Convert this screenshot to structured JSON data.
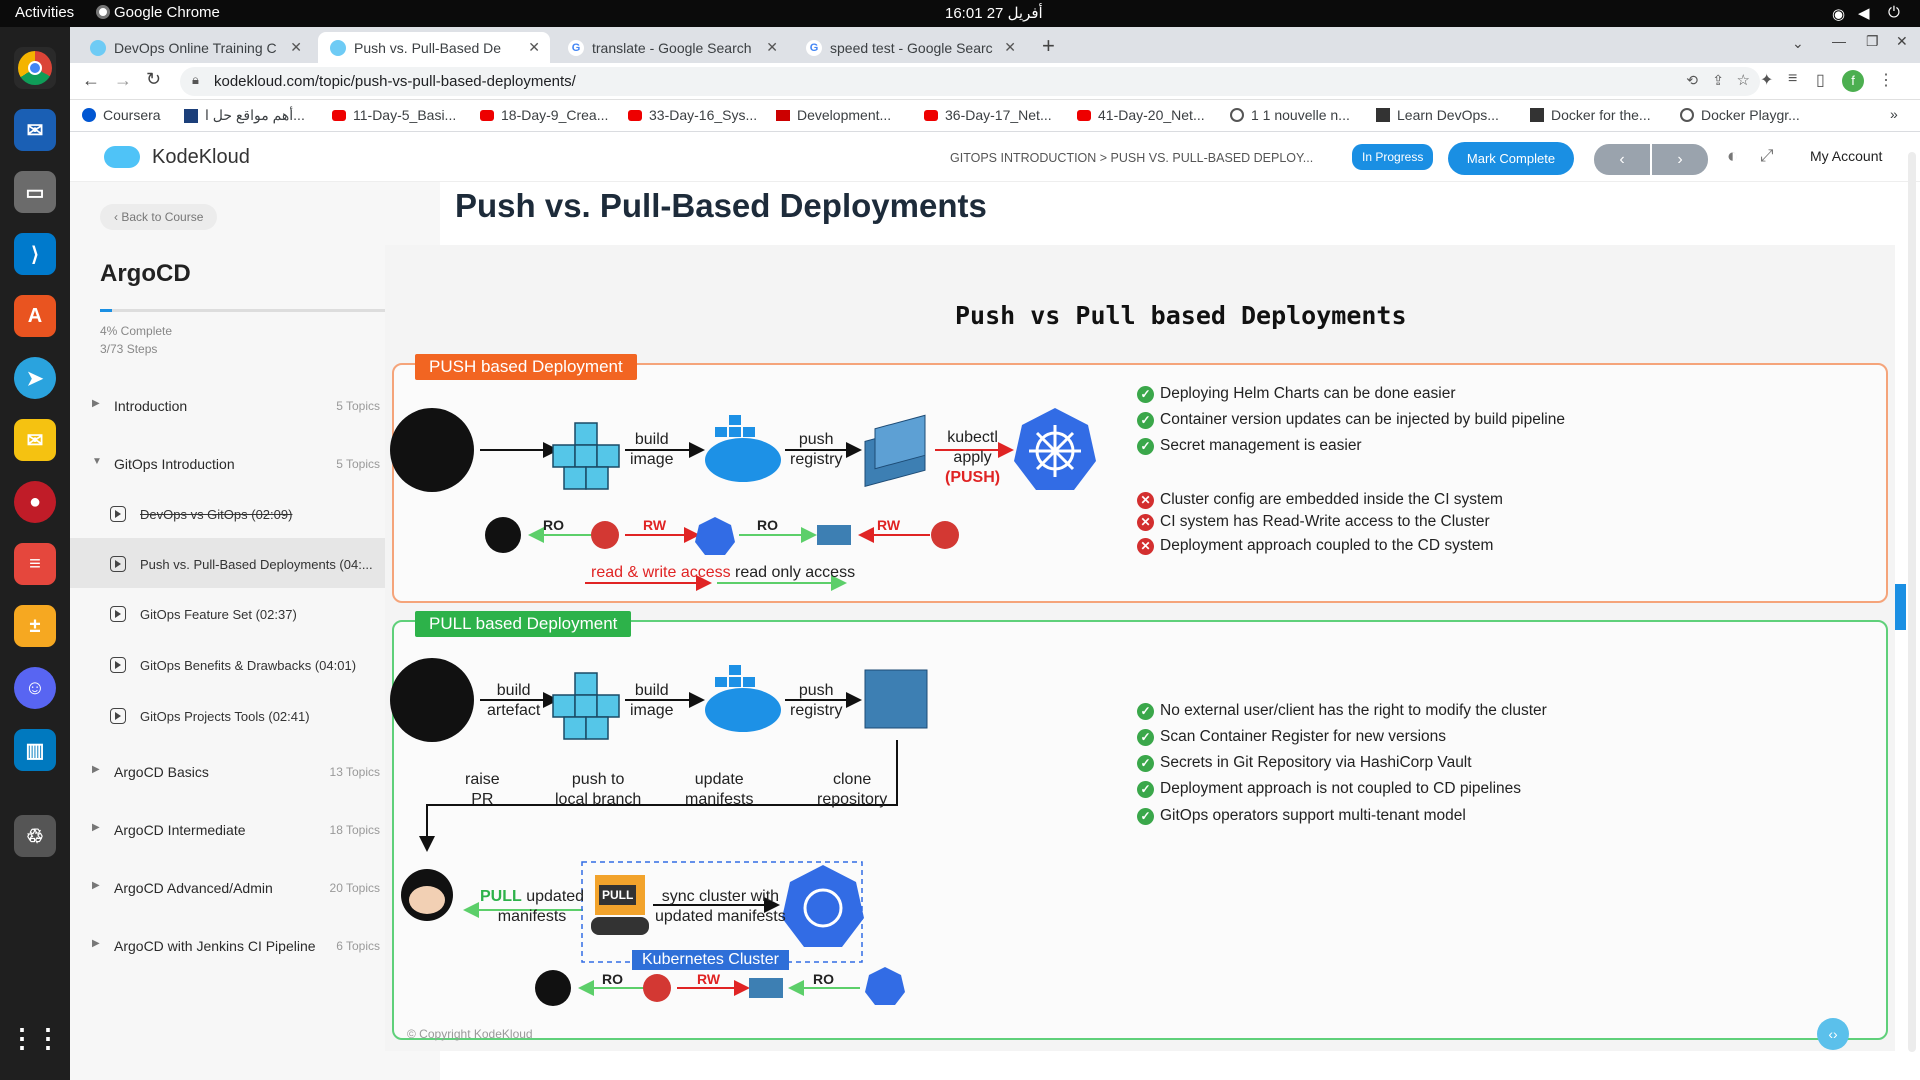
{
  "os": {
    "activities": "Activities",
    "app": "Google Chrome",
    "clock": "16:01  27 أفريل"
  },
  "tabs": [
    {
      "title": "DevOps Online Training C"
    },
    {
      "title": "Push vs. Pull-Based De"
    },
    {
      "title": "translate - Google Search"
    },
    {
      "title": "speed test - Google Searc"
    }
  ],
  "url": "kodekloud.com/topic/push-vs-pull-based-deployments/",
  "bookmarks": [
    "Coursera",
    "أهم مواقع حل ا...",
    "11-Day-5_Basi...",
    "18-Day-9_Crea...",
    "33-Day-16_Sys...",
    "Development...",
    "36-Day-17_Net...",
    "41-Day-20_Net...",
    "1 1 nouvelle n...",
    "Learn DevOps...",
    "Docker for the...",
    "Docker Playgr..."
  ],
  "header": {
    "brand": "KodeKloud",
    "breadcrumb": "GITOPS INTRODUCTION > PUSH VS. PULL-BASED DEPLOY...",
    "status_badge": "In Progress",
    "mark_complete": "Mark Complete",
    "account": "My Account"
  },
  "sidebar": {
    "back": "Back to Course",
    "course_title": "ArgoCD",
    "progress_pct": 4,
    "complete_text": "4% Complete",
    "steps_text": "3/73 Steps",
    "topics": [
      {
        "label": "Introduction",
        "count": "5 Topics"
      },
      {
        "label": "GitOps Introduction",
        "count": "5 Topics"
      },
      {
        "label": "ArgoCD Basics",
        "count": "13 Topics"
      },
      {
        "label": "ArgoCD Intermediate",
        "count": "18 Topics"
      },
      {
        "label": "ArgoCD Advanced/Admin",
        "count": "20 Topics"
      },
      {
        "label": "ArgoCD with Jenkins CI Pipeline",
        "count": "6 Topics"
      }
    ],
    "lessons": [
      {
        "label": "DevOps vs GitOps (02:09)"
      },
      {
        "label": "Push vs. Pull-Based Deployments (04:..."
      },
      {
        "label": "GitOps Feature Set (02:37)"
      },
      {
        "label": "GitOps Benefits & Drawbacks (04:01)"
      },
      {
        "label": "GitOps Projects Tools (02:41)"
      }
    ]
  },
  "page_title": "Push vs. Pull-Based Deployments",
  "slide": {
    "title": "Push vs Pull based Deployments",
    "push_heading": "PUSH based Deployment",
    "pull_heading": "PULL based Deployment",
    "push_labels": {
      "build": "build",
      "image": "image",
      "push": "push",
      "registry": "registry",
      "kubectl": "kubectl",
      "apply": "apply",
      "push_caps": "(PUSH)"
    },
    "push_access": {
      "ro1": "RO",
      "rw1": "RW",
      "ro2": "RO",
      "rw2": "RW",
      "rw_access": "read & write access",
      "ro_access": "read only access"
    },
    "push_pros": [
      "Deploying Helm Charts can be done easier",
      "Container version updates can be injected by build pipeline",
      "Secret management is easier"
    ],
    "push_cons": [
      "Cluster config are embedded inside the CI system",
      "CI system has Read-Write access to the Cluster",
      "Deployment approach coupled to the CD system"
    ],
    "pull_labels": {
      "build1": "build",
      "artefact": "artefact",
      "build2": "build",
      "image": "image",
      "push": "push",
      "registry": "registry",
      "raise": "raise",
      "pr": "PR",
      "push_to": "push to",
      "local_branch": "local branch",
      "update": "update",
      "manifests": "manifests",
      "clone": "clone",
      "repository": "repository",
      "pull": "PULL",
      "updated": "updated",
      "manifests2": "manifests",
      "sync1": "sync cluster with",
      "sync2": "updated manifests",
      "cluster": "Kubernetes Cluster",
      "robot": "PULL"
    },
    "pull_access": {
      "ro1": "RO",
      "rw": "RW",
      "ro2": "RO"
    },
    "pull_pros": [
      "No external user/client has the right to modify the cluster",
      "Scan Container Register for new versions",
      "Secrets in Git Repository via HashiCorp Vault",
      "Deployment approach is not coupled to CD pipelines",
      "GitOps operators support multi-tenant model"
    ],
    "copyright": "© Copyright KodeKloud"
  },
  "colors": {
    "accent": "#1a8fe3",
    "push": "#f26522",
    "pull": "#2db24a",
    "k8s": "#326ce5"
  }
}
